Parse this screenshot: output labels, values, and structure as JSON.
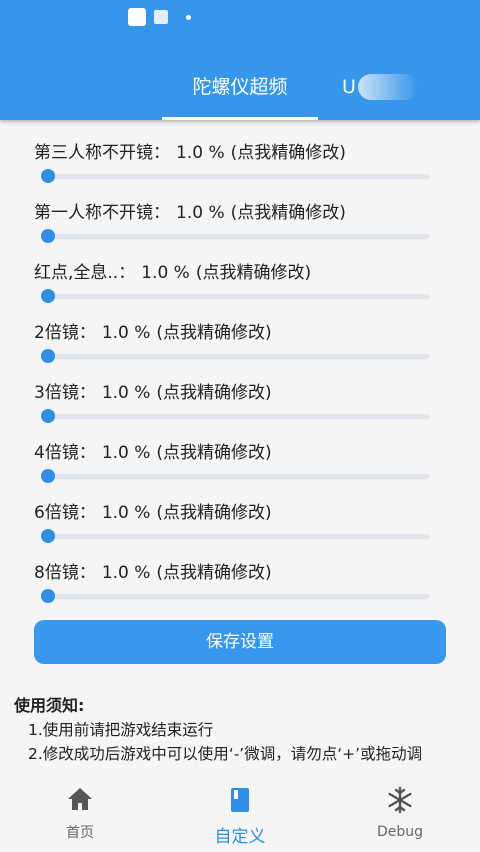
{
  "header": {
    "tabs": [
      {
        "label": "陀螺仪超频",
        "active": true
      },
      {
        "label": "U",
        "active": false
      }
    ]
  },
  "sliders": [
    {
      "label": "第三人称不开镜：",
      "value": "1.0 %",
      "hint": "(点我精确修改)",
      "level": 0
    },
    {
      "label": "第一人称不开镜：",
      "value": "1.0 %",
      "hint": "(点我精确修改)",
      "level": 0
    },
    {
      "label": "红点,全息..：",
      "value": "1.0 %",
      "hint": "(点我精确修改)",
      "level": 0
    },
    {
      "label": "2倍镜：",
      "value": "1.0 %",
      "hint": "(点我精确修改)",
      "level": 0
    },
    {
      "label": "3倍镜：",
      "value": "1.0 %",
      "hint": "(点我精确修改)",
      "level": 0
    },
    {
      "label": "4倍镜：",
      "value": "1.0 %",
      "hint": "(点我精确修改)",
      "level": 0
    },
    {
      "label": "6倍镜：",
      "value": "1.0 %",
      "hint": "(点我精确修改)",
      "level": 0
    },
    {
      "label": "8倍镜：",
      "value": "1.0 %",
      "hint": "(点我精确修改)",
      "level": 0
    }
  ],
  "save_button": {
    "label": "保存设置"
  },
  "notice": {
    "title": "使用须知:",
    "items": [
      "1.使用前请把游戏结束运行",
      "2.修改成功后游戏中可以使用‘-’微调，请勿点‘+’或拖动调"
    ]
  },
  "bottom_nav": {
    "items": [
      {
        "label": "首页",
        "icon": "home-icon",
        "active": false
      },
      {
        "label": "自定义",
        "icon": "book-icon",
        "active": true
      },
      {
        "label": "Debug",
        "icon": "snowflake-icon",
        "active": false
      }
    ]
  },
  "colors": {
    "primary": "#3696ea",
    "slider": "#2f8fe7",
    "track": "#e2e6ea",
    "nav_inactive": "#666666"
  }
}
